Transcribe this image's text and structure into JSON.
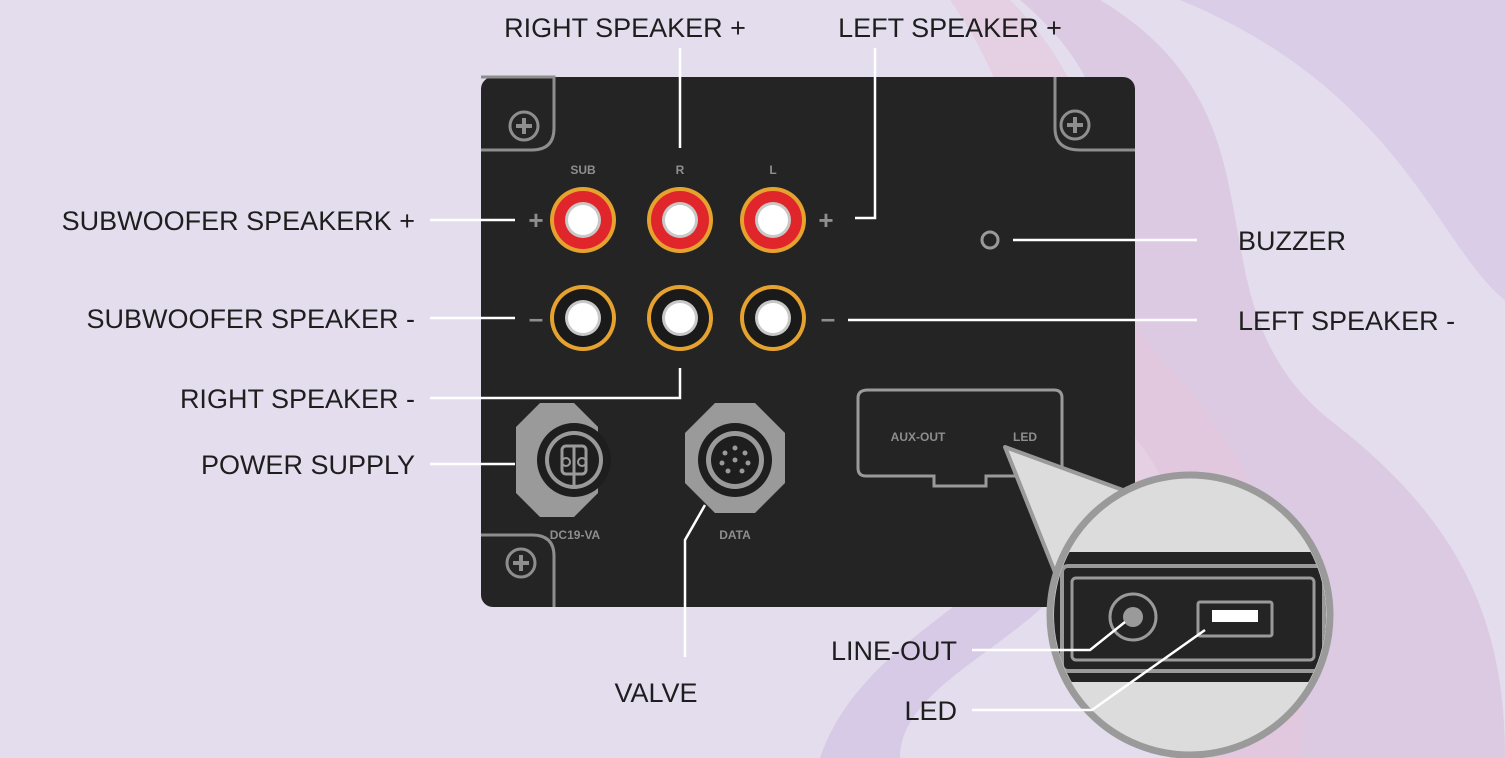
{
  "labels": {
    "right_speaker_plus": "RIGHT SPEAKER +",
    "left_speaker_plus": "LEFT SPEAKER +",
    "subwoofer_plus": "SUBWOOFER SPEAKERK +",
    "subwoofer_minus": "SUBWOOFER SPEAKER -",
    "right_speaker_minus": "RIGHT SPEAKER -",
    "power_supply": "POWER SUPPLY",
    "valve": "VALVE",
    "buzzer": "BUZZER",
    "left_speaker_minus": "LEFT SPEAKER -",
    "line_out": "LINE-OUT",
    "led": "LED"
  },
  "panel": {
    "terminal_sub": "SUB",
    "terminal_r": "R",
    "terminal_l": "L",
    "plus_sign": "+",
    "minus_sign": "–",
    "dc_label": "DC19-VA",
    "data_label": "DATA",
    "aux_out": "AUX-OUT",
    "led": "LED"
  },
  "colors": {
    "background": "#e3dded",
    "panel": "#242424",
    "terminal_red": "#e0262a",
    "terminal_ring": "#e6a22e",
    "leader_line": "#ffffff",
    "label_text": "#1e1e1e"
  }
}
